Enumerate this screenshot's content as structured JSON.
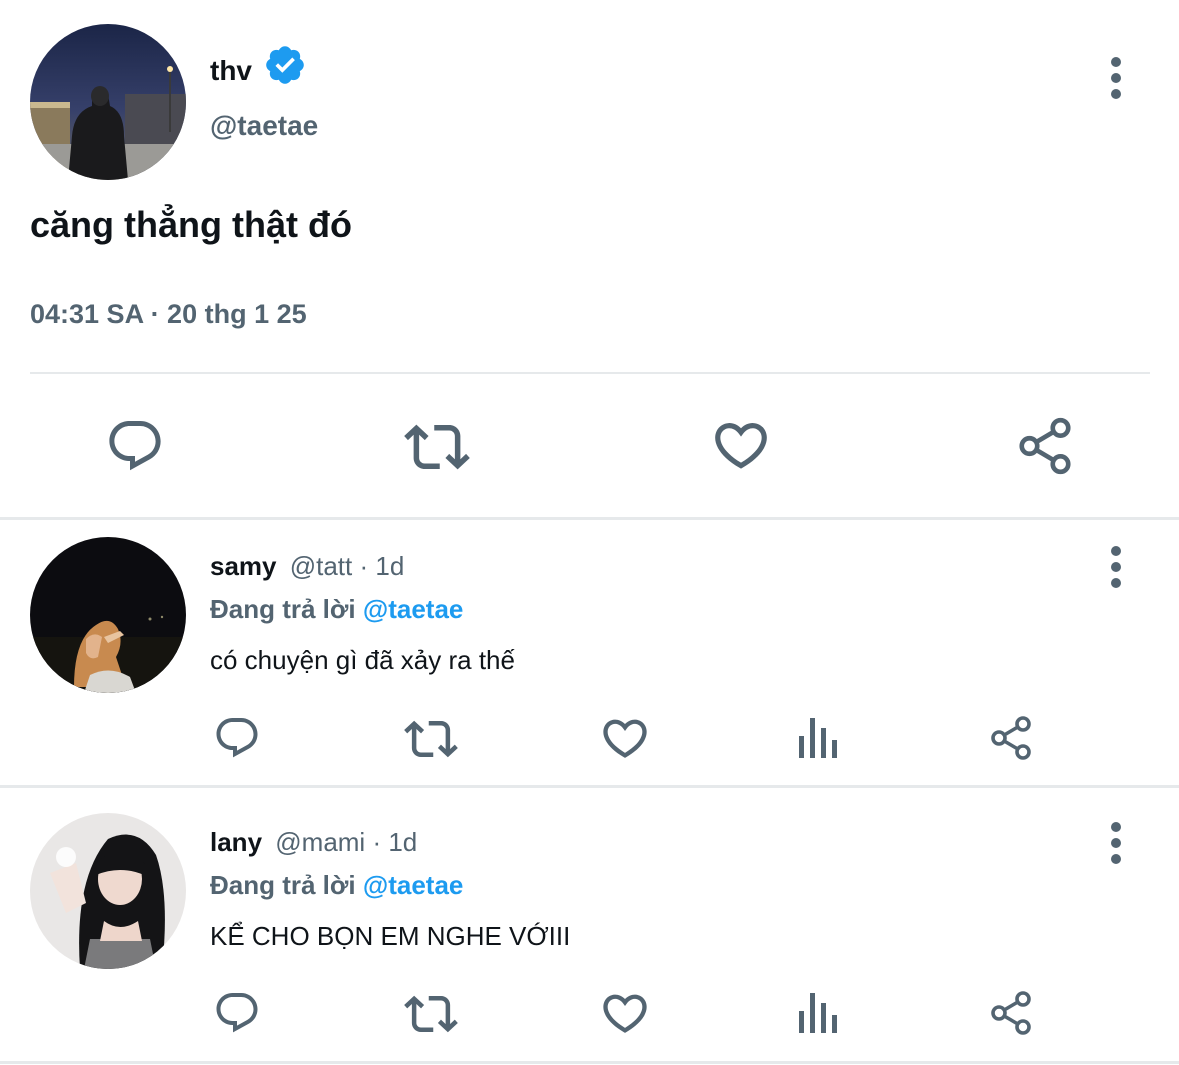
{
  "main_tweet": {
    "author_name": "thv",
    "verified": true,
    "handle": "@taetae",
    "text": "căng thẳng thật đó",
    "timestamp": "04:31 SA · 20 thg 1 25",
    "actions": [
      "reply-icon",
      "retweet-icon",
      "like-icon",
      "share-icon"
    ]
  },
  "replies": [
    {
      "author_name": "samy",
      "handle": "@tatt",
      "time": "· 1d",
      "replying_prefix": "Đang trả lời",
      "replying_to": "@taetae",
      "text": "có chuyện gì đã xảy ra thế",
      "actions": [
        "reply-icon",
        "retweet-icon",
        "like-icon",
        "views-icon",
        "share-icon"
      ]
    },
    {
      "author_name": "lany",
      "handle": "@mami",
      "time": "· 1d",
      "replying_prefix": "Đang trả lời",
      "replying_to": "@taetae",
      "text": "KỂ CHO BỌN EM NGHE VỚIII",
      "actions": [
        "reply-icon",
        "retweet-icon",
        "like-icon",
        "views-icon",
        "share-icon"
      ]
    }
  ],
  "colors": {
    "accent": "#1d9bf0",
    "text": "#0f1419",
    "secondary": "#536471",
    "divider": "#e6e9eb"
  }
}
